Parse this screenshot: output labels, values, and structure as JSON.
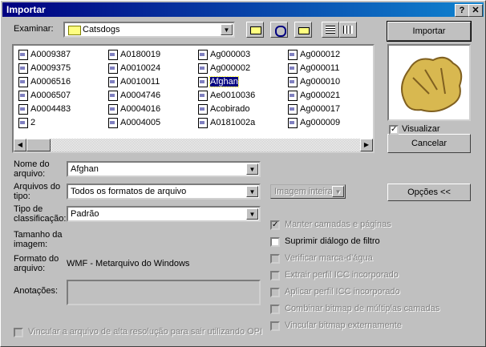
{
  "window": {
    "title": "Importar",
    "help_label": "?",
    "close_label": "✕"
  },
  "look_in": {
    "label": "Examinar:",
    "value": "Catsdogs"
  },
  "files": [
    [
      "2",
      "A0004005",
      "A0181002a",
      "Ag000009"
    ],
    [
      "A0004483",
      "A0004016",
      "Acobirado",
      "Ag000017"
    ],
    [
      "A0006507",
      "A0004746",
      "Ae0010036",
      "Ag000021"
    ],
    [
      "A0006516",
      "A0010011",
      "Afghan",
      "Ag000010"
    ],
    [
      "A0009375",
      "A0010024",
      "Ag000002",
      "Ag000011"
    ],
    [
      "A0009387",
      "A0180019",
      "Ag000003",
      "Ag000012"
    ]
  ],
  "selected_file": "Afghan",
  "file_name": {
    "label": "Nome do arquivo:",
    "value": "Afghan"
  },
  "file_type": {
    "label": "Arquivos do tipo:",
    "value": "Todos os formatos de arquivo"
  },
  "sort_type": {
    "label": "Tipo de classificação:",
    "value": "Padrão"
  },
  "image_size": {
    "label": "Tamanho da imagem:"
  },
  "file_format": {
    "label": "Formato do arquivo:",
    "value": "WMF - Metarquivo do Windows"
  },
  "notes": {
    "label": "Anotações:"
  },
  "full_image_combo": "Imagem inteira",
  "options": [
    {
      "label": "Vincular bitmap externamente",
      "checked": false,
      "enabled": false
    },
    {
      "label": "Combinar bitmap de múltiplas camadas",
      "checked": false,
      "enabled": false
    },
    {
      "label": "Aplicar perfil ICC incorporado",
      "checked": false,
      "enabled": false
    },
    {
      "label": "Extrair perfil ICC incorporado",
      "checked": false,
      "enabled": false
    },
    {
      "label": "Verificar marca-d'água",
      "checked": false,
      "enabled": false
    },
    {
      "label": "Suprimir diálogo de filtro",
      "checked": false,
      "enabled": true
    },
    {
      "label": "Manter camadas e páginas",
      "checked": true,
      "enabled": false
    }
  ],
  "low_res_option": "Vincular a arquivo de alta resolução para sair utilizando OPI",
  "preview_label": "Visualizar",
  "buttons": {
    "import": "Importar",
    "cancel": "Cancelar",
    "options": "Opções <<"
  }
}
